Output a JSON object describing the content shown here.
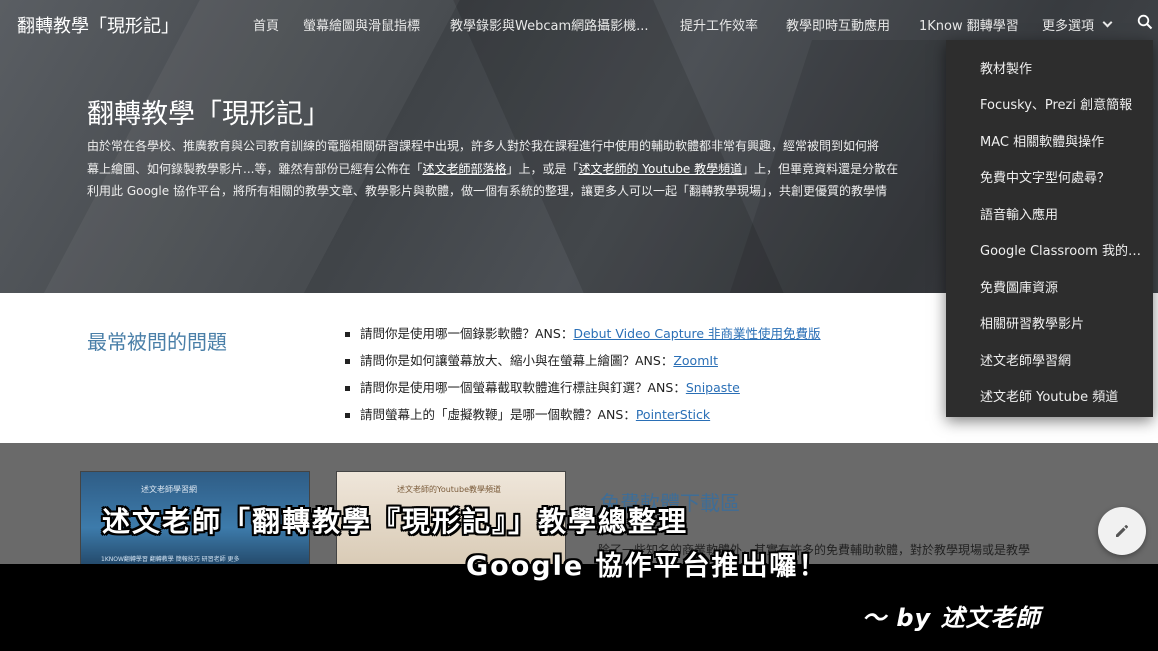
{
  "header": {
    "site_title": "翻轉教學「現形記」",
    "nav": [
      "首頁",
      "螢幕繪圖與滑鼠指標",
      "教學錄影與Webcam網路攝影機...",
      "提升工作效率",
      "教學即時互動應用",
      "1Know 翻轉學習"
    ],
    "more_label": "更多選項",
    "search_icon": "search-icon"
  },
  "hero": {
    "title": "翻轉教學「現形記」",
    "line1": "由於常在各學校、推廣教育與公司教育訓練的電腦相關研習課程中出現，許多人對於我在課程進行中使用的輔助軟體都非常有興趣，經常被問到如何將",
    "line2_pre": "幕上繪圖、如何錄製教學影片...等，雖然有部份已經有公佈在「",
    "line2_link1": "述文老師部落格",
    "line2_mid": "」上，或是「",
    "line2_link2": "述文老師的 Youtube 教學頻道",
    "line2_post": "」上，但畢竟資料還是分散在",
    "line3": "利用此 Google 協作平台，將所有相關的教學文章、教學影片與軟體，做一個有系統的整理，讓更多人可以一起「翻轉教學現場」，共創更優質的教學情"
  },
  "faq": {
    "heading": "最常被問的問題",
    "items": [
      {
        "text": "請問你是使用哪一個錄影軟體？ANS：",
        "link": "Debut Video Capture 非商業性使用免費版"
      },
      {
        "text": "請問你是如何讓螢幕放大、縮小與在螢幕上繪圖？ANS：",
        "link": "ZoomIt"
      },
      {
        "text": "請問你是使用哪一個螢幕截取軟體進行標註與釘選？ANS：",
        "link": "Snipaste"
      },
      {
        "text": "請問螢幕上的「虛擬教鞭」是哪一個軟體？ANS：",
        "link": "PointerStick"
      }
    ]
  },
  "dropdown": {
    "items": [
      "教材製作",
      "Focusky、Prezi 創意簡報",
      "MAC 相關軟體與操作",
      "免費中文字型何處尋？",
      "語音輸入應用",
      "Google Classroom 我的雲端教室",
      "免費圖庫資源",
      "相關研習教學影片",
      "述文老師學習網",
      "述文老師 Youtube 頻道"
    ]
  },
  "lower": {
    "thumb1_caption": "述文老師學習網",
    "thumb1_strip": "1KNOW翻轉學習   翻轉教學   簡報技巧   研習老師   更多",
    "thumb2_caption": "述文老師的Youtube教學頻道",
    "downloads_title": "免費軟體下載區",
    "downloads_desc": "除了一些知名的商業軟體外，其實有許多的免費輔助軟體，對於教學現場或是教學"
  },
  "captions": {
    "line1": "述文老師「翻轉教學『現形記』」教學總整理",
    "line2": "Google 協作平台推出囉！",
    "line3": "～ by 述文老師"
  }
}
